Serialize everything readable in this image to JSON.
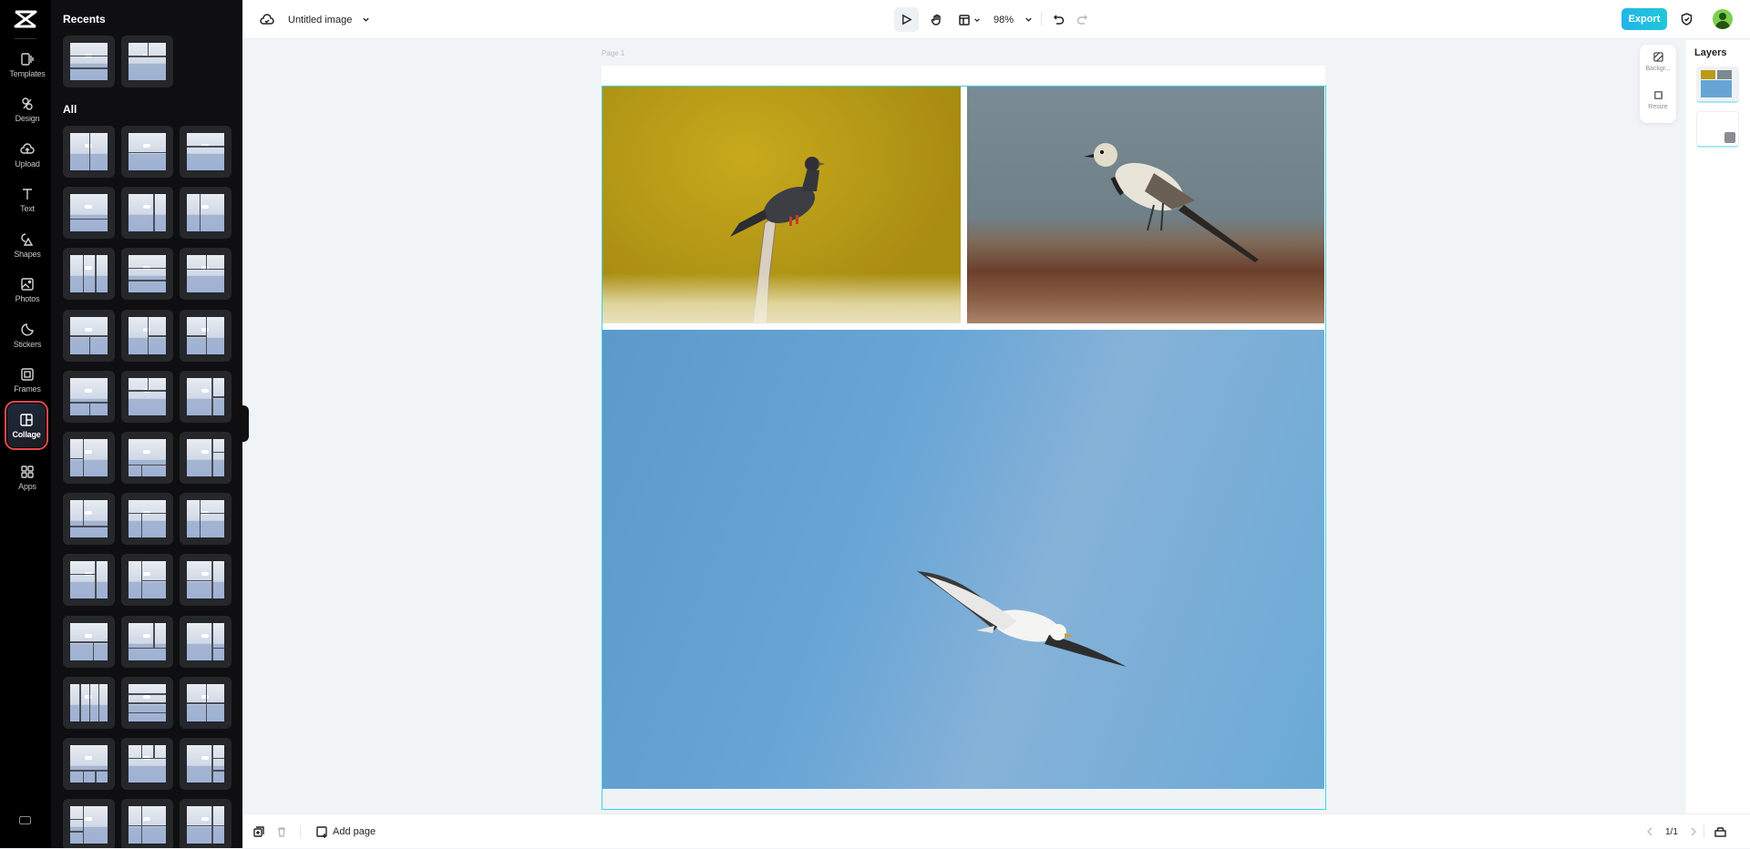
{
  "app": {
    "logo": "capcut-logo",
    "document_title": "Untitled image"
  },
  "rail": {
    "items": [
      {
        "label": "Templates",
        "icon": "templates-icon"
      },
      {
        "label": "Design",
        "icon": "design-icon"
      },
      {
        "label": "Upload",
        "icon": "upload-cloud-icon"
      },
      {
        "label": "Text",
        "icon": "text-icon"
      },
      {
        "label": "Shapes",
        "icon": "shapes-icon"
      },
      {
        "label": "Photos",
        "icon": "photos-icon"
      },
      {
        "label": "Stickers",
        "icon": "stickers-icon"
      },
      {
        "label": "Frames",
        "icon": "frames-icon"
      },
      {
        "label": "Collage",
        "icon": "collage-icon",
        "active": true
      },
      {
        "label": "Apps",
        "icon": "apps-icon"
      }
    ],
    "bottom_icon": "keyboard-shortcuts-icon"
  },
  "panel": {
    "recents_heading": "Recents",
    "all_heading": "All",
    "recent_layouts": [
      "3-rows",
      "2-top-1-bottom"
    ],
    "all_layouts": [
      "2-columns",
      "2-rows",
      "1-top-small-1-bottom",
      "1-top-1-bottom-small",
      "2-columns-left-wide",
      "2-columns-right-wide",
      "3-columns",
      "3-rows",
      "2-top-1-bottom",
      "1-top-2-bottom",
      "1-left-2-right",
      "2-left-1-right",
      "1-top-2-bottom-small",
      "2-top-small-1-bottom",
      "1-left-2-right-stack",
      "2-left-1-right-stack",
      "1-top-2-bottom-wide",
      "1-left-2-right-narrow",
      "2-top-1-bottom-wide",
      "1-top-2-bottom-split",
      "1-left-2-right-split",
      "2-left-stack-1-right",
      "1-left-2-right-stack-b",
      "2-left-1-right-b",
      "1-top-2-bottom-c",
      "2-top-1-bottom-c",
      "1-left-2-right-c",
      "4-columns",
      "4-rows",
      "2x2-grid",
      "1-top-3-bottom",
      "3-top-1-bottom",
      "1-left-3-right",
      "3-left-1-right",
      "2x2-grid-b",
      "2x2-grid-c"
    ]
  },
  "toolbar": {
    "cloud_icon": "cloud-sync-icon",
    "title_chevron": "chevron-down-icon",
    "select_tool": "pointer-icon",
    "hand_tool": "hand-icon",
    "layout_tool": "layout-icon",
    "zoom_level": "98%",
    "undo": "undo-icon",
    "redo": "redo-icon",
    "export_label": "Export",
    "shield_icon": "shield-check-icon",
    "avatar": "user-avatar"
  },
  "canvas": {
    "page_label": "Page 1",
    "photos": [
      {
        "subject": "pigeon perched on branch",
        "background": "yellow water"
      },
      {
        "subject": "white wagtail on driftwood",
        "background": "blue-gray water"
      },
      {
        "subject": "seagull in flight",
        "background": "blue sky"
      }
    ]
  },
  "floating_tools": [
    {
      "label": "Backgr...",
      "icon": "background-icon"
    },
    {
      "label": "Resize",
      "icon": "resize-icon"
    }
  ],
  "layers": {
    "heading": "Layers",
    "items": [
      {
        "name": "collage-layer"
      },
      {
        "name": "background-layer"
      }
    ]
  },
  "bottombar": {
    "duplicate_icon": "duplicate-page-icon",
    "delete_icon": "trash-icon",
    "add_page_label": "Add page",
    "page_counter": "1/1",
    "prev_icon": "chevron-left-icon",
    "next_icon": "chevron-right-icon",
    "more_icon": "page-manager-icon"
  },
  "colors": {
    "accent": "#21b6e8",
    "selection": "#3bd3e6",
    "active_outline": "#e5484d"
  }
}
